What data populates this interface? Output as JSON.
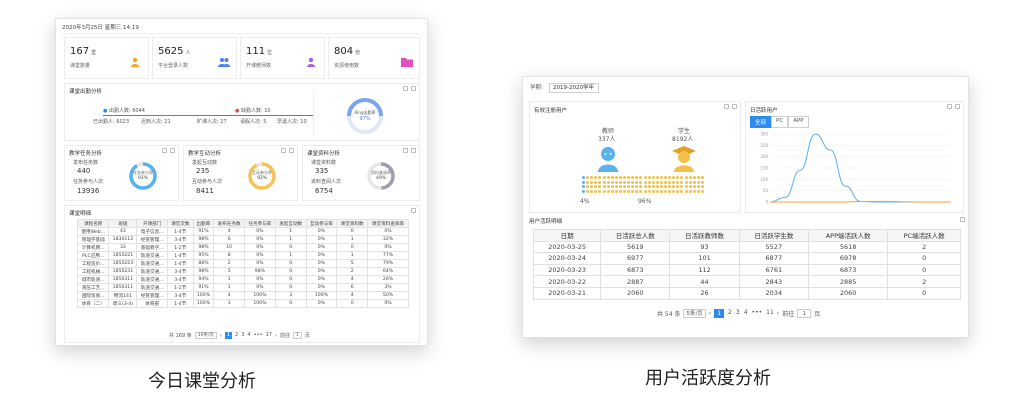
{
  "left": {
    "caption": "今日课堂分析",
    "date_bar": "2020年3月25日   星期三   14:19",
    "stats": [
      {
        "value": "167",
        "unit": "堂",
        "label": "课堂数量",
        "color": "#f5a623"
      },
      {
        "value": "5625",
        "unit": "人",
        "label": "平台登录人数",
        "color": "#4a7ff5"
      },
      {
        "value": "111",
        "unit": "位",
        "label": "开课教师数",
        "color": "#b25ce0"
      },
      {
        "value": "804",
        "unit": "份",
        "label": "资源使用数",
        "color": "#e04ec0"
      }
    ],
    "attendance": {
      "title": "课堂出勤分析",
      "items": [
        {
          "label": "出勤人数: 6044"
        },
        {
          "label": "缺勤人数: 10"
        }
      ],
      "sub": [
        "已出勤人: 6023",
        "迟到人次: 21",
        "旷课人次: 27",
        "请假人次: 5",
        "早退人次: 10"
      ],
      "gauge_label": "Ring出勤率",
      "gauge_value": "97%"
    },
    "panels": [
      {
        "title": "教学任务分析",
        "l1": "发布任务数",
        "v1": "440",
        "l2": "任务参与人次",
        "v2": "13936",
        "ring_label": "任务参与率",
        "ring_value": "91%",
        "ring_color": "#5ab1ef",
        "ring_frac": 0.91
      },
      {
        "title": "教学互动分析",
        "l1": "发起互动数",
        "v1": "235",
        "l2": "互动参与人次",
        "v2": "8411",
        "ring_label": "互动参与率",
        "ring_value": "92%",
        "ring_color": "#f7c359",
        "ring_frac": 0.92
      },
      {
        "title": "课堂资料分析",
        "l1": "课堂资料数",
        "v1": "335",
        "l2": "资料查阅人次",
        "v2": "6754",
        "ring_label": "资料查阅率",
        "ring_value": "49%",
        "ring_color": "#9aa0ac",
        "ring_frac": 0.49
      }
    ],
    "detail": {
      "title": "课堂明细",
      "headers": [
        "课程名称",
        "班级",
        "开课部门",
        "课堂次数",
        "出勤率",
        "发布任务数",
        "任务参与率",
        "发起互动数",
        "互动参与率",
        "课堂资料数",
        "课堂资料查阅率"
      ],
      "rows": [
        [
          "使用Web...",
          "43",
          "电子信息...",
          "1-4节",
          "91%",
          "4",
          "0%",
          "1",
          "0%",
          "0",
          "0%"
        ],
        [
          "管理学基础",
          "1830112",
          "经管管理...",
          "3-4节",
          "98%",
          "6",
          "0%",
          "1",
          "0%",
          "1",
          "32%"
        ],
        [
          "计算机网...",
          "33",
          "基础教学...",
          "1-2节",
          "98%",
          "10",
          "0%",
          "0",
          "0%",
          "0",
          "0%"
        ],
        [
          "PLC应用...",
          "1850221",
          "轨道交通...",
          "1-4节",
          "95%",
          "8",
          "0%",
          "1",
          "0%",
          "1",
          "77%"
        ],
        [
          "工程造价...",
          "1850223",
          "轨道交通...",
          "1-4节",
          "88%",
          "2",
          "0%",
          "0",
          "0%",
          "5",
          "79%"
        ],
        [
          "工程机械...",
          "1850231",
          "轨道交通...",
          "3-4节",
          "98%",
          "5",
          "98%",
          "0",
          "0%",
          "2",
          "64%"
        ],
        [
          "城市轨道...",
          "1850311",
          "轨道交通...",
          "3-4节",
          "94%",
          "1",
          "0%",
          "0",
          "0%",
          "4",
          "26%"
        ],
        [
          "液压工艺...",
          "1850311",
          "轨道交通...",
          "1-2节",
          "91%",
          "1",
          "0%",
          "0",
          "0%",
          "6",
          "3%"
        ],
        [
          "国际贸易...",
          "物流141",
          "经管管理...",
          "3-4节",
          "100%",
          "4",
          "100%",
          "3",
          "100%",
          "4",
          "50%"
        ],
        [
          "体育（二）",
          "周三(3-4)",
          "体育部",
          "1-4节",
          "100%",
          "3",
          "100%",
          "0",
          "0%",
          "0",
          "0%"
        ]
      ],
      "pager": {
        "total": "共 169 条",
        "size": "10条/页",
        "pages": [
          "1",
          "2",
          "3",
          "4",
          "•••",
          "17"
        ],
        "goto": "前往",
        "page": "1",
        "page_unit": "页"
      }
    }
  },
  "right": {
    "caption": "用户活跃度分析",
    "term_label": "学期:",
    "term_value": "2019-2020学年",
    "reg_title": "有效注册用户",
    "teacher_label": "教师",
    "teacher_value": "337人",
    "student_label": "学生",
    "student_value": "8192人",
    "teacher_pct": "4%",
    "student_pct": "96%",
    "active_title": "日活跃用户",
    "tabs": [
      "全部",
      "PC",
      "APP"
    ],
    "detail_title": "用户活跃明细",
    "headers": [
      "日期",
      "日活跃总人数",
      "日活跃教师数",
      "日活跃学生数",
      "APP端活跃人数",
      "PC端活跃人数"
    ],
    "rows": [
      [
        "2020-03-25",
        "5619",
        "93",
        "5527",
        "5618",
        "2"
      ],
      [
        "2020-03-24",
        "6977",
        "101",
        "6877",
        "6978",
        "0"
      ],
      [
        "2020-03-23",
        "6873",
        "112",
        "6761",
        "6873",
        "0"
      ],
      [
        "2020-03-22",
        "2887",
        "44",
        "2843",
        "2885",
        "2"
      ],
      [
        "2020-03-21",
        "2060",
        "26",
        "2034",
        "2060",
        "0"
      ]
    ],
    "pager": {
      "total": "共 54 条",
      "size": "5条/页",
      "pages": [
        "1",
        "2",
        "3",
        "4",
        "•••",
        "11"
      ],
      "goto": "前往",
      "page": "1",
      "page_unit": "页"
    }
  },
  "chart_data": {
    "type": "line",
    "title": "日活跃用户",
    "y_ticks": [
      "300",
      "250",
      "200",
      "150",
      "100",
      "50",
      "0"
    ],
    "ylim": [
      0,
      300
    ],
    "series": [
      {
        "values": [
          0,
          20,
          140,
          300,
          230,
          70,
          3,
          0,
          0,
          0,
          0,
          0,
          0
        ],
        "color": "#5ab1ef"
      },
      {
        "values": [
          0,
          0,
          0,
          0,
          0,
          0,
          2,
          3,
          2,
          1,
          0,
          0,
          0
        ],
        "color": "#f5a623"
      }
    ],
    "colors": {
      "primary": "#5ab1ef",
      "secondary": "#f5a623"
    }
  }
}
